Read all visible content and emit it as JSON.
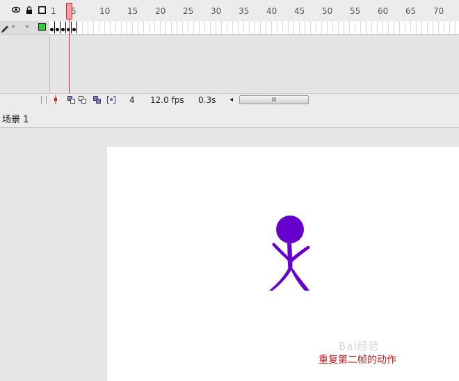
{
  "timeline": {
    "header_icons": [
      "eye-icon",
      "lock-icon",
      "outline-square-icon"
    ],
    "ruler_labels": [
      "1",
      "5",
      "10",
      "15",
      "20",
      "25",
      "30",
      "35",
      "40",
      "45",
      "50",
      "55",
      "60",
      "65",
      "70"
    ],
    "layer_icons": [
      "pencil-icon",
      "outline-color-square-icon"
    ],
    "layer_color": "#33cc33",
    "keyframe_count": 5,
    "current_frame_marker": "5"
  },
  "status": {
    "frame": "4",
    "fps": "12.0 fps",
    "time": "0.3s",
    "scroll_left_arrow": "◂",
    "scroll_thumb_grip": "III",
    "tool_icons": [
      "onion-skin-marker-icon",
      "onion-skin-icon",
      "onion-outline-icon",
      "edit-multiple-frames-icon",
      "modify-markers-icon"
    ]
  },
  "scene": {
    "label": "场景 1"
  },
  "stage": {
    "figure_color": "#6600cc",
    "caption": "重复第二帧的动作",
    "watermark": "Bai经验"
  }
}
